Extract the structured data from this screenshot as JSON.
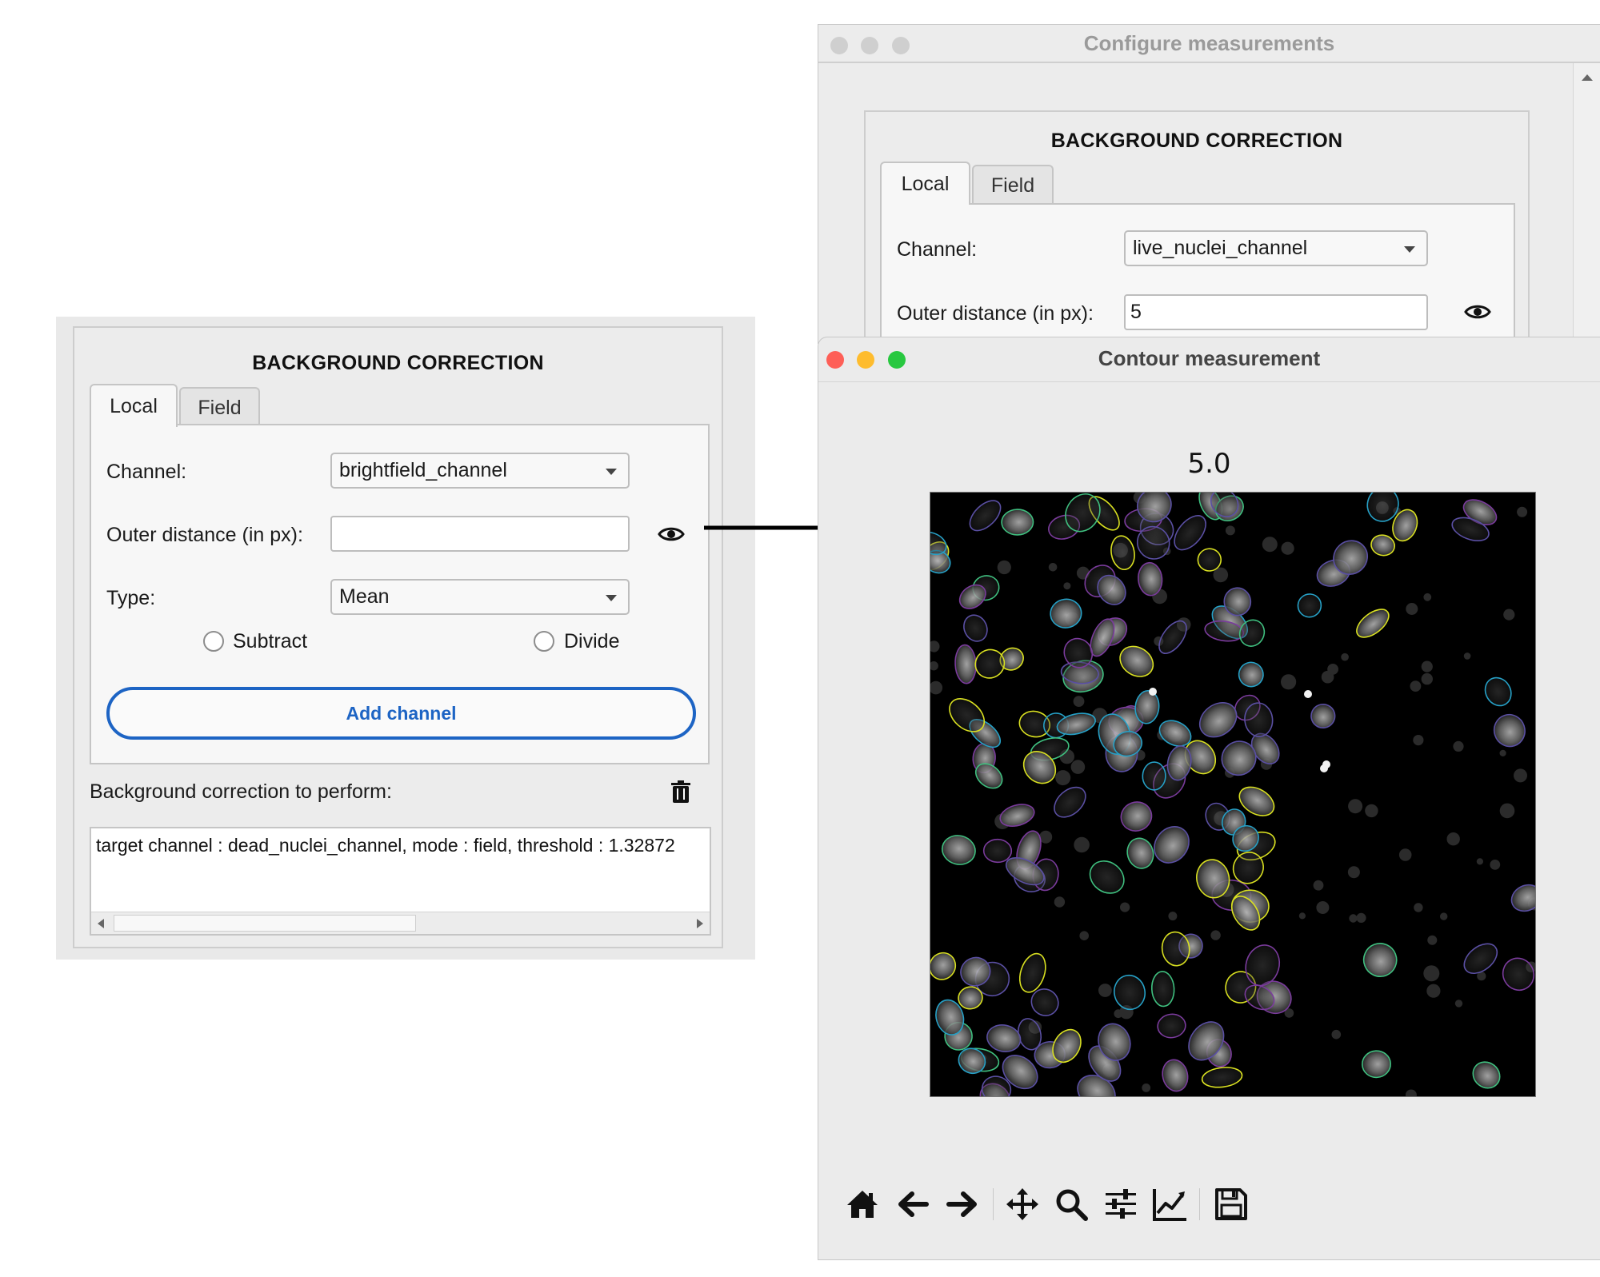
{
  "left_panel": {
    "section_title": "BACKGROUND CORRECTION",
    "tabs": [
      {
        "label": "Local"
      },
      {
        "label": "Field"
      }
    ],
    "channel_label": "Channel:",
    "channel_value": "brightfield_channel",
    "outer_distance_label": "Outer distance (in px):",
    "outer_distance_value": "",
    "type_label": "Type:",
    "type_value": "Mean",
    "radio_subtract": "Subtract",
    "radio_divide": "Divide",
    "add_button": "Add channel",
    "list_title": "Background correction to perform:",
    "list_items": [
      "target channel : dead_nuclei_channel, mode : field, threshold : 1.32872"
    ]
  },
  "back_window": {
    "title": "Configure measurements",
    "section_title": "BACKGROUND CORRECTION",
    "tabs": [
      {
        "label": "Local"
      },
      {
        "label": "Field"
      }
    ],
    "channel_label": "Channel:",
    "channel_value": "live_nuclei_channel",
    "outer_distance_label": "Outer distance (in px):",
    "outer_distance_value": "5"
  },
  "front_window": {
    "title": "Contour measurement",
    "plot_title": "5.0",
    "toolbar": [
      {
        "icon": "home-icon"
      },
      {
        "icon": "back-arrow-icon"
      },
      {
        "icon": "forward-arrow-icon"
      },
      {
        "icon": "pan-icon"
      },
      {
        "icon": "zoom-icon"
      },
      {
        "icon": "subplots-config-icon"
      },
      {
        "icon": "edit-axes-icon"
      },
      {
        "icon": "save-icon"
      }
    ]
  },
  "colors": {
    "accent_blue": "#1d64c4",
    "traffic_red": "#fe5f57",
    "traffic_yellow": "#febc2e",
    "traffic_green": "#28c840",
    "traffic_inactive": "#cfcfcf",
    "contour_colors": [
      "#d9e021",
      "#3fbf7f",
      "#26a0c6",
      "#5a4fa3",
      "#7a3b9c"
    ]
  }
}
